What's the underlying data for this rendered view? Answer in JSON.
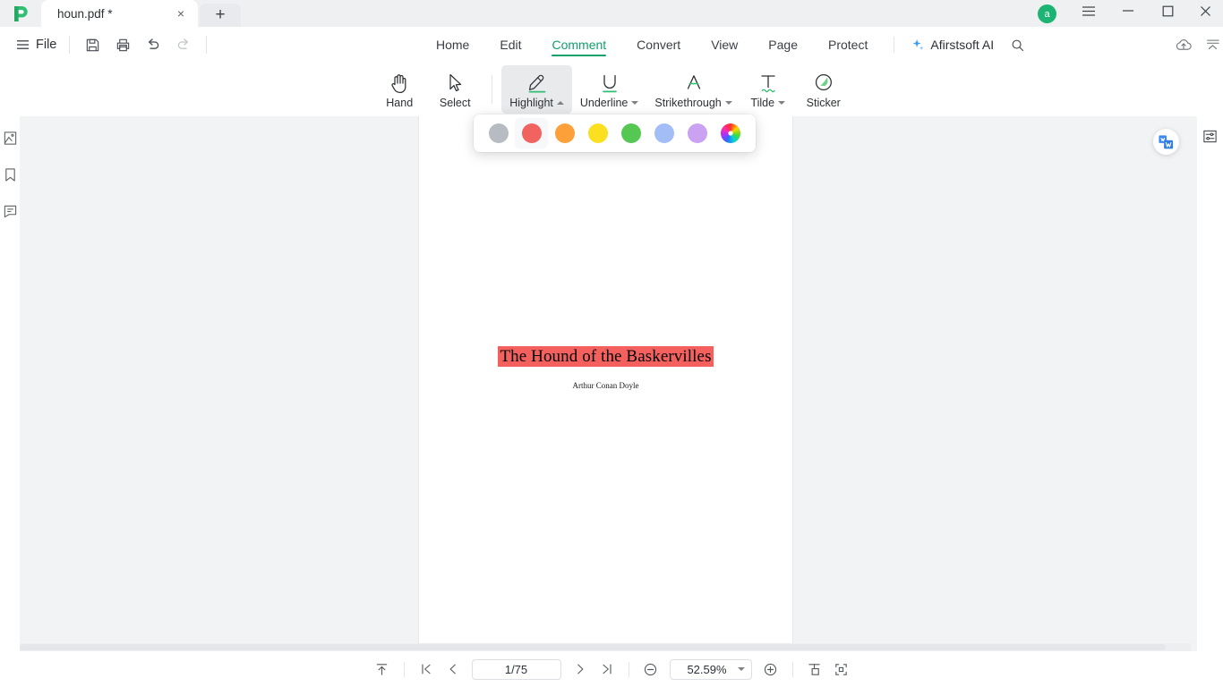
{
  "window": {
    "app_logo": "afirstsoft-logo",
    "tabs": [
      {
        "title": "houn.pdf *",
        "close_label": "×"
      }
    ],
    "new_tab_label": "+",
    "avatar_initial": "a",
    "controls": {
      "menu": "hamburger-icon",
      "minimize": "minimize-icon",
      "maximize": "maximize-icon",
      "close": "close-icon"
    }
  },
  "menubar": {
    "file_label": "File",
    "quick_actions": [
      {
        "name": "save-as",
        "label": "save-as-icon"
      },
      {
        "name": "print",
        "label": "print-icon"
      },
      {
        "name": "undo",
        "label": "undo-icon"
      },
      {
        "name": "redo",
        "label": "redo-icon"
      }
    ],
    "tabs": [
      {
        "label": "Home",
        "active": false
      },
      {
        "label": "Edit",
        "active": false
      },
      {
        "label": "Comment",
        "active": true
      },
      {
        "label": "Convert",
        "active": false
      },
      {
        "label": "View",
        "active": false
      },
      {
        "label": "Page",
        "active": false
      },
      {
        "label": "Protect",
        "active": false
      }
    ],
    "ai_label": "Afirstsoft AI",
    "search_label": "search-icon",
    "cloud_label": "cloud-upload-icon",
    "collapse_label": "collapse-ribbon-icon"
  },
  "ribbon": {
    "tools": [
      {
        "name": "hand",
        "label": "Hand",
        "has_caret": false,
        "active": false
      },
      {
        "name": "select",
        "label": "Select",
        "has_caret": false,
        "active": false
      },
      {
        "name": "highlight",
        "label": "Highlight",
        "has_caret": true,
        "caret": "up",
        "active": true
      },
      {
        "name": "underline",
        "label": "Underline",
        "has_caret": true,
        "caret": "down",
        "active": false
      },
      {
        "name": "strikethrough",
        "label": "Strikethrough",
        "has_caret": true,
        "caret": "down",
        "active": false
      },
      {
        "name": "tilde",
        "label": "Tilde",
        "has_caret": true,
        "caret": "down",
        "active": false
      },
      {
        "name": "sticker",
        "label": "Sticker",
        "has_caret": false,
        "active": false
      }
    ]
  },
  "color_popup": {
    "open": true,
    "swatches": [
      {
        "name": "gray",
        "color": "#b6bcc2",
        "selected": false
      },
      {
        "name": "red",
        "color": "#f0635f",
        "selected": true
      },
      {
        "name": "orange",
        "color": "#fca139",
        "selected": false
      },
      {
        "name": "yellow",
        "color": "#fbdf21",
        "selected": false
      },
      {
        "name": "green",
        "color": "#55c853",
        "selected": false
      },
      {
        "name": "blue",
        "color": "#a3bdf6",
        "selected": false
      },
      {
        "name": "purple",
        "color": "#cba2f1",
        "selected": false
      },
      {
        "name": "custom",
        "color": "rainbow",
        "selected": false
      }
    ]
  },
  "sidebar": {
    "items": [
      {
        "name": "thumbnails",
        "label": "thumbnail-icon"
      },
      {
        "name": "bookmarks",
        "label": "bookmark-icon"
      },
      {
        "name": "comments",
        "label": "comment-icon"
      }
    ]
  },
  "document": {
    "title": "The Hound of the Baskervilles",
    "title_highlight_color": "#f4605e",
    "author": "Arthur Conan Doyle"
  },
  "right_rail": {
    "convert_fab": "convert-to-word-icon",
    "properties": "properties-panel-icon"
  },
  "statusbar": {
    "scroll_top_label": "scroll-to-top-icon",
    "first_page_label": "first-page-icon",
    "prev_page_label": "previous-page-icon",
    "page_value": "1/75",
    "next_page_label": "next-page-icon",
    "last_page_label": "last-page-icon",
    "zoom_out_label": "zoom-out-icon",
    "zoom_value": "52.59%",
    "zoom_in_label": "zoom-in-icon",
    "fit_page_label": "fit-page-icon",
    "fit_width_label": "fit-width-icon"
  }
}
